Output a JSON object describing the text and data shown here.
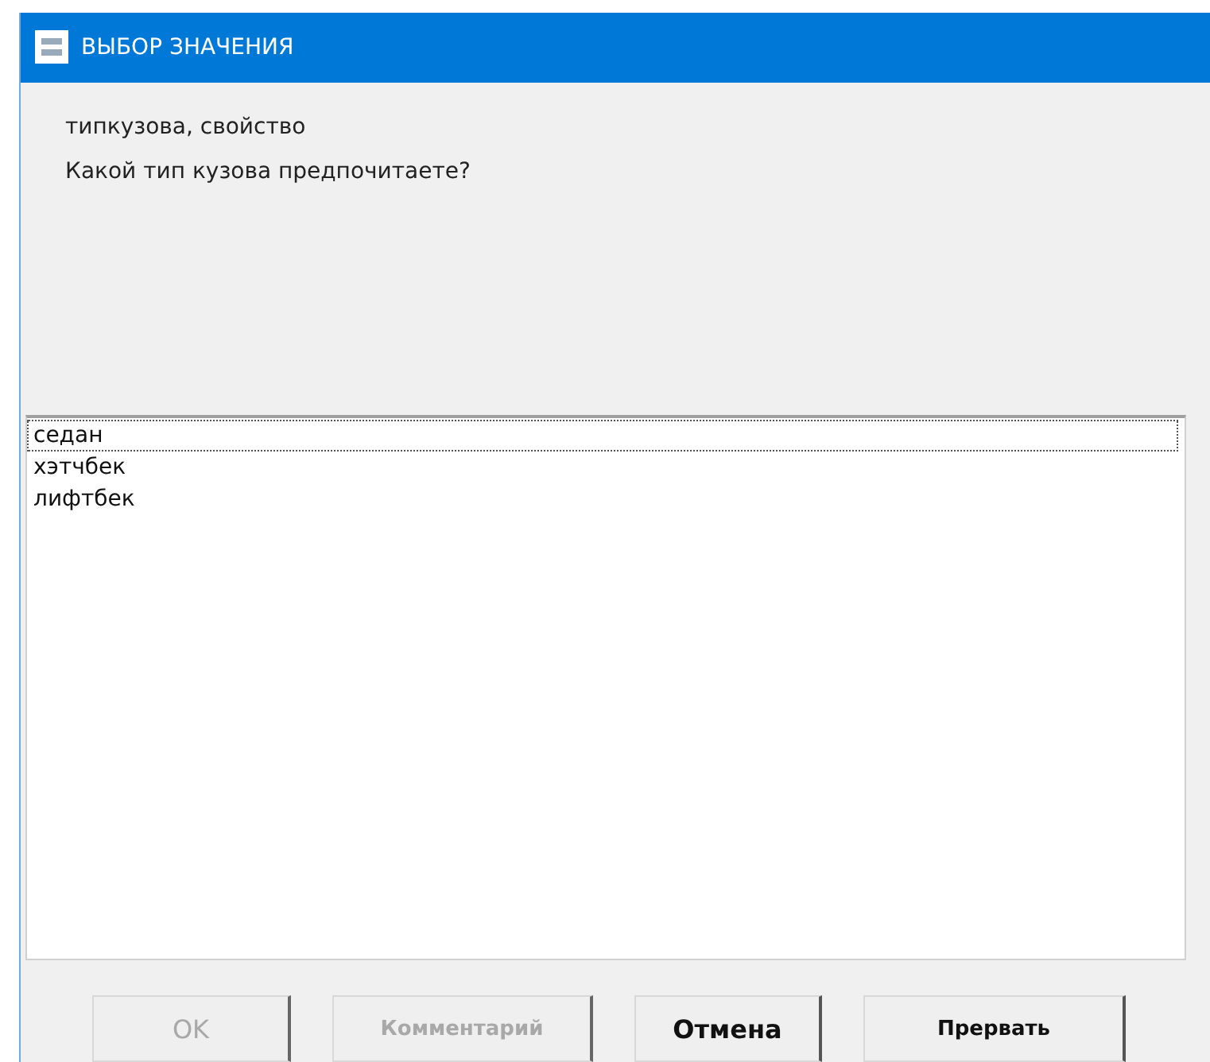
{
  "window": {
    "title": "ВЫБОР ЗНАЧЕНИЯ"
  },
  "property_label": "типкузова, свойство",
  "question": "Какой тип кузова предпочитаете?",
  "options": [
    {
      "label": "седан",
      "selected": true
    },
    {
      "label": "хэтчбек",
      "selected": false
    },
    {
      "label": "лифтбек",
      "selected": false
    }
  ],
  "buttons": [
    {
      "label": "OK",
      "disabled": true,
      "kind": "normal"
    },
    {
      "label": "Комментарий",
      "disabled": true,
      "kind": "small"
    },
    {
      "label": "Отмена",
      "disabled": false,
      "kind": "normal"
    },
    {
      "label": "Прервать",
      "disabled": false,
      "kind": "small"
    }
  ]
}
